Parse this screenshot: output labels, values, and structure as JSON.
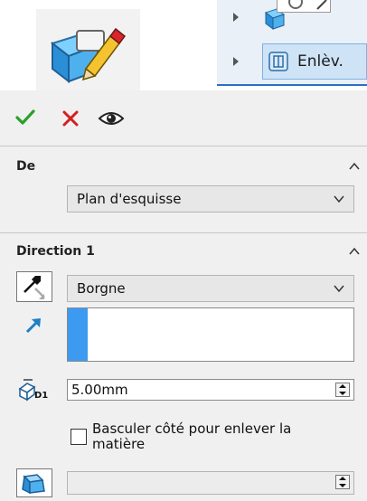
{
  "tree": {
    "selected_item": "Enlèv."
  },
  "toolbar": {
    "ok_icon": "check-icon",
    "cancel_icon": "close-icon",
    "preview_icon": "eye-icon",
    "ok_color": "#2aa02a",
    "cancel_color": "#d42020"
  },
  "from_section": {
    "title": "De",
    "start_condition": "Plan d'esquisse"
  },
  "direction1": {
    "title": "Direction 1",
    "end_condition": "Borgne",
    "depth_value": "5.00mm",
    "depth_icon_label": "D1",
    "flip_checkbox_label": "Basculer côté pour enlever la matière",
    "flip_checked": false
  },
  "colors": {
    "accent": "#3c9bf0",
    "selection_line": "#2d6fc3"
  }
}
